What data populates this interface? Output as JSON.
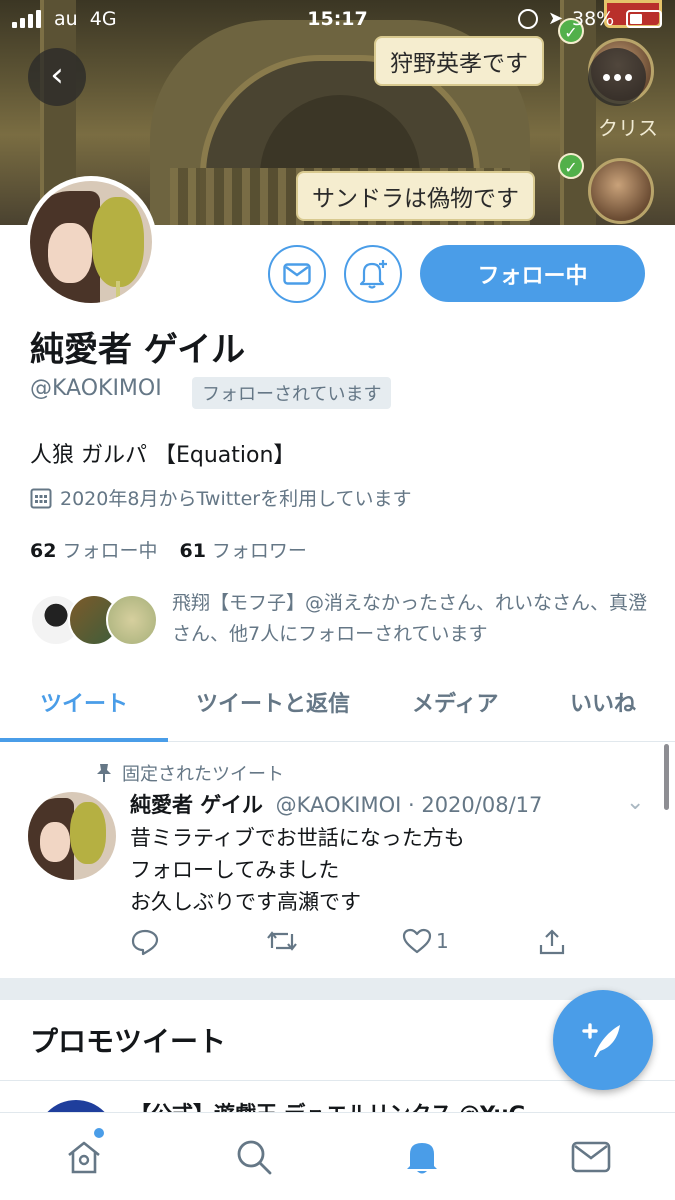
{
  "status_bar": {
    "carrier": "au",
    "network": "4G",
    "time": "15:17",
    "battery": "38%"
  },
  "header": {
    "bubble_1": "狩野英孝です",
    "bubble_2": "サンドラは偽物です",
    "name_tag": "クリス"
  },
  "profile": {
    "name": "純愛者 ゲイル",
    "handle": "@KAOKIMOI",
    "follows_you": "フォローされています",
    "bio": "人狼 ガルパ 【Equation】",
    "joined": "2020年8月からTwitterを利用しています",
    "following_count": "62",
    "following_label": "フォロー中",
    "followers_count": "61",
    "followers_label": "フォロワー",
    "follow_button": "フォロー中",
    "followed_by": "飛翔【モフ子】@消えなかったさん、れいなさん、真澄さん、他7人にフォローされています"
  },
  "tabs": [
    "ツイート",
    "ツイートと返信",
    "メディア",
    "いいね"
  ],
  "pinned_tweet": {
    "label": "固定されたツイート",
    "name": "純愛者 ゲイル",
    "meta": "@KAOKIMOI · 2020/08/17",
    "lines": [
      "昔ミラティブでお世話になった方も",
      "フォローしてみました",
      "お久しぶりです高瀬です"
    ],
    "like_count": "1"
  },
  "promo": {
    "title": "プロモツイート",
    "row": "【公式】遊戯王 デュエルリンクス  @YuG..."
  },
  "colors": {
    "accent": "#4a9de8",
    "secondary_text": "#657786"
  }
}
